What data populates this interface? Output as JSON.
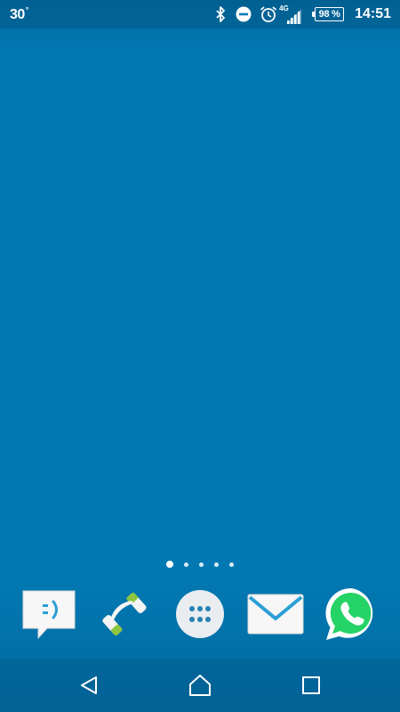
{
  "status_bar": {
    "temperature": "30",
    "temperature_unit": "°",
    "network_type": "4G",
    "battery_percent": "98 %",
    "battery_level": 0.98,
    "time": "14:51",
    "icons": [
      "bluetooth-icon",
      "do-not-disturb-icon",
      "alarm-clock-icon",
      "cell-signal-icon",
      "battery-icon"
    ]
  },
  "home_screen": {
    "page_count": 5,
    "active_page": 1
  },
  "dock": {
    "apps": [
      {
        "icon": "messaging-icon"
      },
      {
        "icon": "phone-icon"
      },
      {
        "icon": "app-drawer-icon"
      },
      {
        "icon": "email-icon"
      },
      {
        "icon": "whatsapp-icon"
      }
    ]
  },
  "nav_bar": {
    "buttons": [
      "back-icon",
      "home-icon",
      "recents-icon"
    ]
  },
  "colors": {
    "wallpaper": "#0279b3",
    "phone_accent": "#8dc63f",
    "whatsapp_green": "#25d366",
    "messaging_accent": "#2a9fd6"
  }
}
